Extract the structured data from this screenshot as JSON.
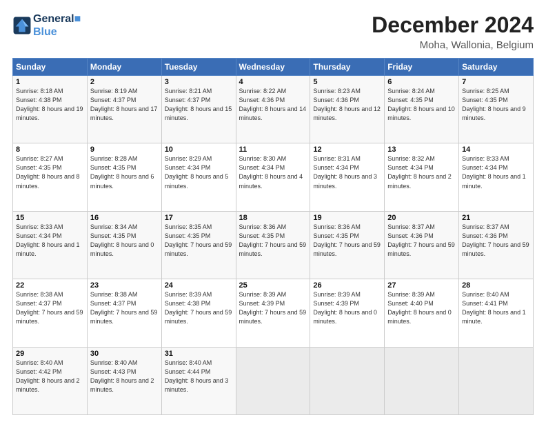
{
  "header": {
    "logo_line1": "General",
    "logo_line2": "Blue",
    "title": "December 2024",
    "subtitle": "Moha, Wallonia, Belgium"
  },
  "days_of_week": [
    "Sunday",
    "Monday",
    "Tuesday",
    "Wednesday",
    "Thursday",
    "Friday",
    "Saturday"
  ],
  "weeks": [
    [
      {
        "day": "1",
        "sunrise": "8:18 AM",
        "sunset": "4:38 PM",
        "daylight": "8 hours and 19 minutes."
      },
      {
        "day": "2",
        "sunrise": "8:19 AM",
        "sunset": "4:37 PM",
        "daylight": "8 hours and 17 minutes."
      },
      {
        "day": "3",
        "sunrise": "8:21 AM",
        "sunset": "4:37 PM",
        "daylight": "8 hours and 15 minutes."
      },
      {
        "day": "4",
        "sunrise": "8:22 AM",
        "sunset": "4:36 PM",
        "daylight": "8 hours and 14 minutes."
      },
      {
        "day": "5",
        "sunrise": "8:23 AM",
        "sunset": "4:36 PM",
        "daylight": "8 hours and 12 minutes."
      },
      {
        "day": "6",
        "sunrise": "8:24 AM",
        "sunset": "4:35 PM",
        "daylight": "8 hours and 10 minutes."
      },
      {
        "day": "7",
        "sunrise": "8:25 AM",
        "sunset": "4:35 PM",
        "daylight": "8 hours and 9 minutes."
      }
    ],
    [
      {
        "day": "8",
        "sunrise": "8:27 AM",
        "sunset": "4:35 PM",
        "daylight": "8 hours and 8 minutes."
      },
      {
        "day": "9",
        "sunrise": "8:28 AM",
        "sunset": "4:35 PM",
        "daylight": "8 hours and 6 minutes."
      },
      {
        "day": "10",
        "sunrise": "8:29 AM",
        "sunset": "4:34 PM",
        "daylight": "8 hours and 5 minutes."
      },
      {
        "day": "11",
        "sunrise": "8:30 AM",
        "sunset": "4:34 PM",
        "daylight": "8 hours and 4 minutes."
      },
      {
        "day": "12",
        "sunrise": "8:31 AM",
        "sunset": "4:34 PM",
        "daylight": "8 hours and 3 minutes."
      },
      {
        "day": "13",
        "sunrise": "8:32 AM",
        "sunset": "4:34 PM",
        "daylight": "8 hours and 2 minutes."
      },
      {
        "day": "14",
        "sunrise": "8:33 AM",
        "sunset": "4:34 PM",
        "daylight": "8 hours and 1 minute."
      }
    ],
    [
      {
        "day": "15",
        "sunrise": "8:33 AM",
        "sunset": "4:34 PM",
        "daylight": "8 hours and 1 minute."
      },
      {
        "day": "16",
        "sunrise": "8:34 AM",
        "sunset": "4:35 PM",
        "daylight": "8 hours and 0 minutes."
      },
      {
        "day": "17",
        "sunrise": "8:35 AM",
        "sunset": "4:35 PM",
        "daylight": "7 hours and 59 minutes."
      },
      {
        "day": "18",
        "sunrise": "8:36 AM",
        "sunset": "4:35 PM",
        "daylight": "7 hours and 59 minutes."
      },
      {
        "day": "19",
        "sunrise": "8:36 AM",
        "sunset": "4:35 PM",
        "daylight": "7 hours and 59 minutes."
      },
      {
        "day": "20",
        "sunrise": "8:37 AM",
        "sunset": "4:36 PM",
        "daylight": "7 hours and 59 minutes."
      },
      {
        "day": "21",
        "sunrise": "8:37 AM",
        "sunset": "4:36 PM",
        "daylight": "7 hours and 59 minutes."
      }
    ],
    [
      {
        "day": "22",
        "sunrise": "8:38 AM",
        "sunset": "4:37 PM",
        "daylight": "7 hours and 59 minutes."
      },
      {
        "day": "23",
        "sunrise": "8:38 AM",
        "sunset": "4:37 PM",
        "daylight": "7 hours and 59 minutes."
      },
      {
        "day": "24",
        "sunrise": "8:39 AM",
        "sunset": "4:38 PM",
        "daylight": "7 hours and 59 minutes."
      },
      {
        "day": "25",
        "sunrise": "8:39 AM",
        "sunset": "4:39 PM",
        "daylight": "7 hours and 59 minutes."
      },
      {
        "day": "26",
        "sunrise": "8:39 AM",
        "sunset": "4:39 PM",
        "daylight": "8 hours and 0 minutes."
      },
      {
        "day": "27",
        "sunrise": "8:39 AM",
        "sunset": "4:40 PM",
        "daylight": "8 hours and 0 minutes."
      },
      {
        "day": "28",
        "sunrise": "8:40 AM",
        "sunset": "4:41 PM",
        "daylight": "8 hours and 1 minute."
      }
    ],
    [
      {
        "day": "29",
        "sunrise": "8:40 AM",
        "sunset": "4:42 PM",
        "daylight": "8 hours and 2 minutes."
      },
      {
        "day": "30",
        "sunrise": "8:40 AM",
        "sunset": "4:43 PM",
        "daylight": "8 hours and 2 minutes."
      },
      {
        "day": "31",
        "sunrise": "8:40 AM",
        "sunset": "4:44 PM",
        "daylight": "8 hours and 3 minutes."
      },
      null,
      null,
      null,
      null
    ]
  ],
  "labels": {
    "sunrise": "Sunrise:",
    "sunset": "Sunset:",
    "daylight": "Daylight:"
  }
}
